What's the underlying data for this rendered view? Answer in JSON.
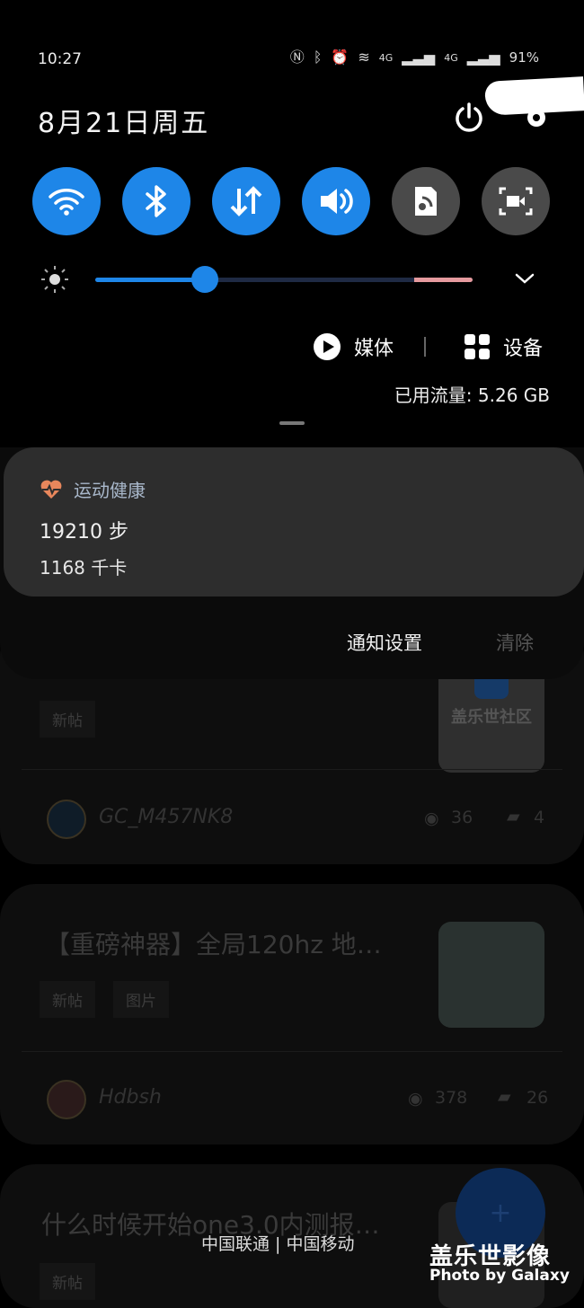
{
  "status": {
    "time": "10:27",
    "icons": [
      "nfc-icon",
      "bluetooth-icon",
      "alarm-icon",
      "wifi-icon",
      "signal-icon",
      "signal-icon"
    ],
    "net1": "4G",
    "net2": "4G",
    "battery": "91%"
  },
  "panel": {
    "date": "8月21日周五",
    "toggles": [
      {
        "name": "wifi",
        "on": true
      },
      {
        "name": "bluetooth",
        "on": true
      },
      {
        "name": "mobile-data",
        "on": true
      },
      {
        "name": "sound",
        "on": true
      },
      {
        "name": "nfc-share",
        "on": false
      },
      {
        "name": "screen-capture",
        "on": false
      }
    ],
    "brightness": 0.29,
    "media_label": "媒体",
    "devices_label": "设备",
    "data_usage": "已用流量: 5.26 GB"
  },
  "notification": {
    "app_name": "运动健康",
    "steps": "19210 步",
    "calories": "1168 千卡",
    "settings_label": "通知设置",
    "clear_label": "清除"
  },
  "feed": {
    "card1": {
      "tag": "新帖",
      "thumb_text": "盖乐世社区",
      "user": "GC_M457NK8",
      "views": "36",
      "comments": "4"
    },
    "card2": {
      "title": "【重磅神器】全局120hz 地…",
      "tags": [
        "新帖",
        "图片"
      ],
      "user": "Hdbsh",
      "views": "378",
      "comments": "26"
    },
    "card3": {
      "title": "什么时候开始one3.0内测报…",
      "tag": "新帖"
    }
  },
  "fab_label": "+",
  "carriers": "中国联通 | 中国移动",
  "watermark": {
    "title": "盖乐世影像",
    "subtitle": "Photo by Galaxy"
  },
  "colors": {
    "accent": "#1e86e8",
    "toggle_off": "#4a4a4a",
    "card": "#2d2d2d"
  }
}
